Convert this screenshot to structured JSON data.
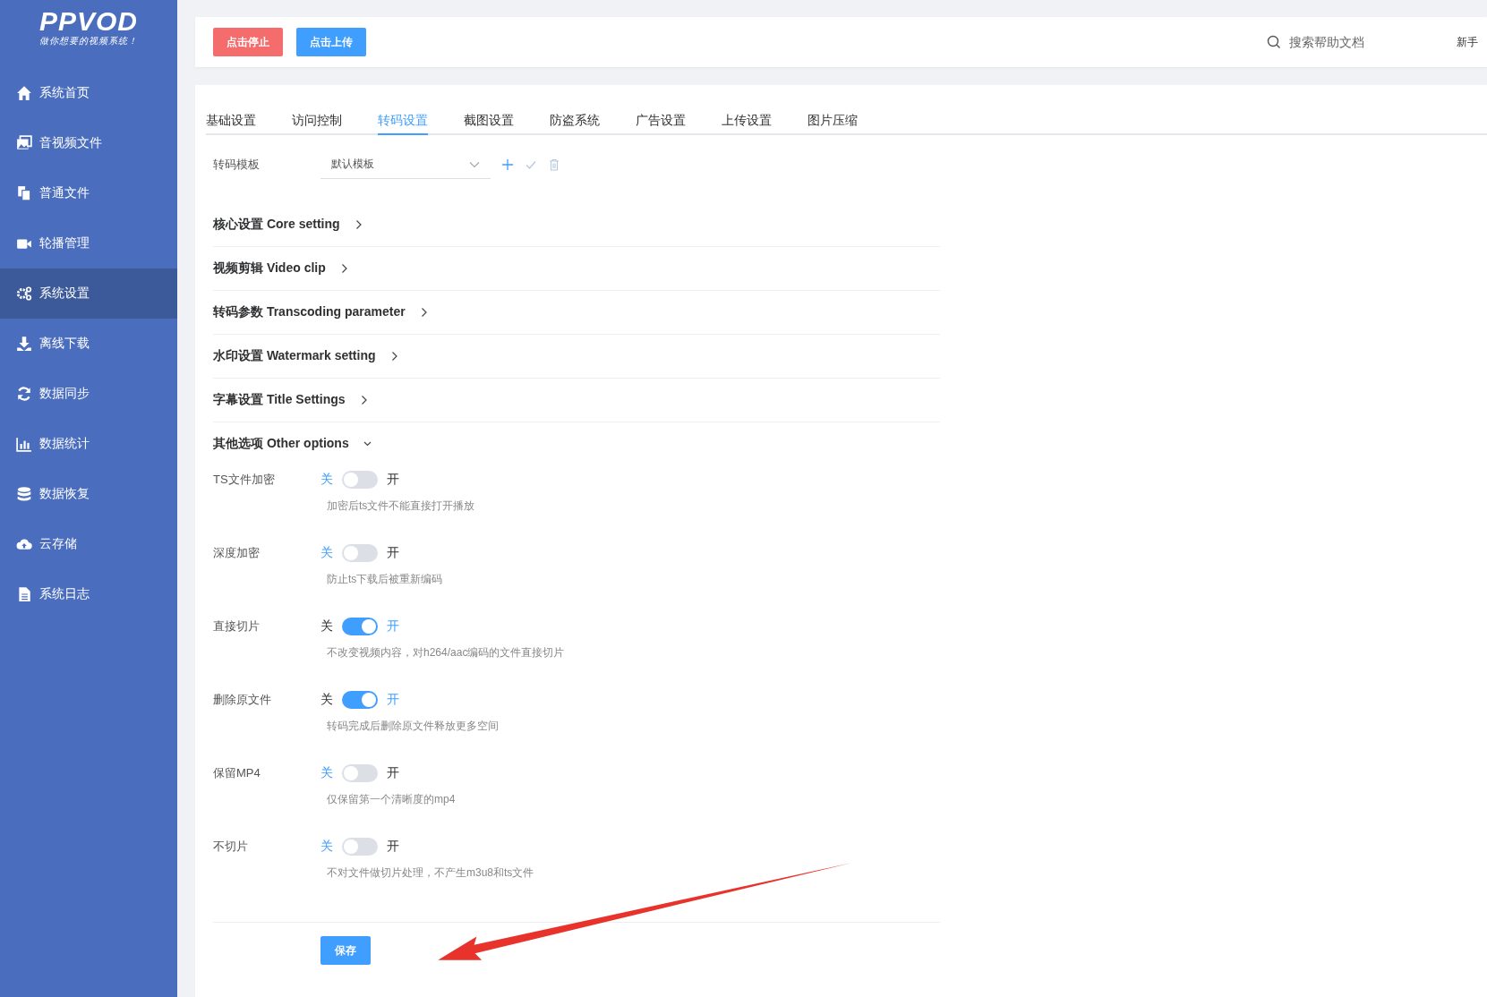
{
  "logo": {
    "title": "PPVOD",
    "slogan": "做你想要的视频系统！"
  },
  "sidebar": {
    "items": [
      {
        "label": "系统首页",
        "selected": false
      },
      {
        "label": "音视频文件",
        "selected": false
      },
      {
        "label": "普通文件",
        "selected": false
      },
      {
        "label": "轮播管理",
        "selected": false
      },
      {
        "label": "系统设置",
        "selected": true
      },
      {
        "label": "离线下载",
        "selected": false
      },
      {
        "label": "数据同步",
        "selected": false
      },
      {
        "label": "数据统计",
        "selected": false
      },
      {
        "label": "数据恢复",
        "selected": false
      },
      {
        "label": "云存储",
        "selected": false
      },
      {
        "label": "系统日志",
        "selected": false
      }
    ]
  },
  "header": {
    "buttons": [
      {
        "label": "点击停止",
        "kind": "danger"
      },
      {
        "label": "点击上传",
        "kind": "primary"
      }
    ],
    "search": {
      "placeholder": "搜索帮助文档"
    },
    "link": "新手"
  },
  "tabs": [
    {
      "label": "基础设置",
      "selected": false
    },
    {
      "label": "访问控制",
      "selected": false
    },
    {
      "label": "转码设置",
      "selected": true
    },
    {
      "label": "截图设置",
      "selected": false
    },
    {
      "label": "防盗系统",
      "selected": false
    },
    {
      "label": "广告设置",
      "selected": false
    },
    {
      "label": "上传设置",
      "selected": false
    },
    {
      "label": "图片压缩",
      "selected": false
    }
  ],
  "template": {
    "label": "转码模板",
    "value": "默认模板"
  },
  "sections": [
    {
      "title": "核心设置 Core setting",
      "expanded": false
    },
    {
      "title": "视频剪辑 Video clip",
      "expanded": false
    },
    {
      "title": "转码参数 Transcoding parameter",
      "expanded": false
    },
    {
      "title": "水印设置 Watermark setting",
      "expanded": false
    },
    {
      "title": "字幕设置 Title Settings",
      "expanded": false
    },
    {
      "title": "其他选项 Other options",
      "expanded": true
    }
  ],
  "options": [
    {
      "label": "TS文件加密",
      "off_label": "关",
      "on_label": "开",
      "on": false,
      "hint": "加密后ts文件不能直接打开播放"
    },
    {
      "label": "深度加密",
      "off_label": "关",
      "on_label": "开",
      "on": false,
      "hint": "防止ts下载后被重新编码"
    },
    {
      "label": "直接切片",
      "off_label": "关",
      "on_label": "开",
      "on": true,
      "hint": "不改变视频内容，对h264/aac编码的文件直接切片"
    },
    {
      "label": "删除原文件",
      "off_label": "关",
      "on_label": "开",
      "on": true,
      "hint": "转码完成后删除原文件释放更多空间"
    },
    {
      "label": "保留MP4",
      "off_label": "关",
      "on_label": "开",
      "on": false,
      "hint": "仅保留第一个清晰度的mp4"
    },
    {
      "label": "不切片",
      "off_label": "关",
      "on_label": "开",
      "on": false,
      "hint": "不对文件做切片处理，不产生m3u8和ts文件"
    }
  ],
  "save_button": "保存"
}
